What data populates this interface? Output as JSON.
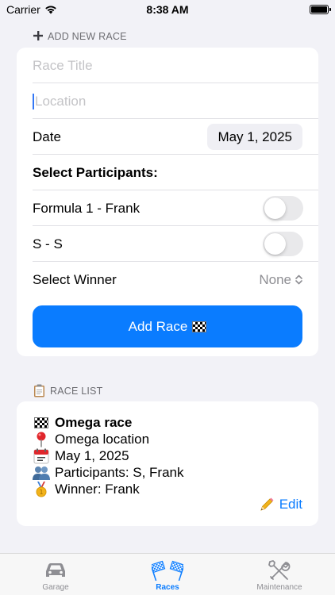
{
  "status": {
    "carrier": "Carrier",
    "time": "8:38 AM"
  },
  "add_section": {
    "header": "ADD NEW RACE"
  },
  "form": {
    "race_title_placeholder": "Race Title",
    "location_placeholder": "Location",
    "date_label": "Date",
    "date_value": "May 1, 2025",
    "participants_heading": "Select Participants:",
    "participants": [
      {
        "name": "Formula 1 - Frank",
        "selected": false
      },
      {
        "name": "S - S",
        "selected": false
      }
    ],
    "winner_label": "Select Winner",
    "winner_value": "None",
    "add_button_label": "Add Race"
  },
  "list_section": {
    "header": "RACE LIST"
  },
  "races": [
    {
      "title": "Omega race",
      "location": "Omega location",
      "date": "May 1, 2025",
      "participants": "Participants: S, Frank",
      "winner": "Winner: Frank",
      "edit_label": "Edit"
    }
  ],
  "tabs": [
    {
      "label": "Garage",
      "icon": "car-icon",
      "active": false
    },
    {
      "label": "Races",
      "icon": "checkered-flags-icon",
      "active": true
    },
    {
      "label": "Maintenance",
      "icon": "tools-icon",
      "active": false
    }
  ],
  "colors": {
    "accent": "#0a7cff",
    "background": "#f2f2f7",
    "inactive": "#8e8e93"
  }
}
